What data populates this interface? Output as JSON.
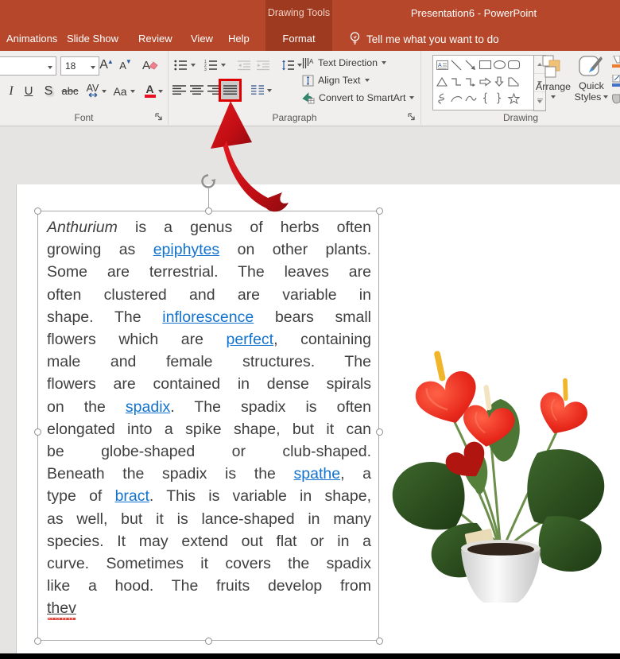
{
  "titlebar": {
    "context_group": "Drawing Tools",
    "title": "Presentation6  -  PowerPoint"
  },
  "tabs": {
    "items": [
      "Animations",
      "Slide Show",
      "Review",
      "View",
      "Help"
    ],
    "context_tab": "Format",
    "tell_me": "Tell me what you want to do"
  },
  "ribbon": {
    "font": {
      "label": "Font",
      "size_value": "18",
      "italic": "I",
      "underline": "U",
      "shadow": "S",
      "strikethrough": "abc",
      "char_spacing": "AV",
      "change_case": "Aa",
      "font_color": "A",
      "grow_font": "A",
      "shrink_font": "A",
      "clear_format": "A"
    },
    "paragraph": {
      "label": "Paragraph",
      "text_direction": "Text Direction",
      "align_text": "Align Text",
      "convert_smartart": "Convert to SmartArt"
    },
    "drawing": {
      "label": "Drawing",
      "arrange": "Arrange",
      "quick_line1": "Quick",
      "quick_line2": "Styles"
    }
  },
  "slide": {
    "textbox": {
      "lines": [
        [
          {
            "t": "Anthurium",
            "s": "i"
          },
          {
            "t": " is a genus of herbs often",
            "s": "n"
          }
        ],
        [
          {
            "t": "growing as ",
            "s": "n"
          },
          {
            "t": "epiphytes",
            "s": "l"
          },
          {
            "t": " on other plants.",
            "s": "n"
          }
        ],
        [
          {
            "t": "Some are terrestrial. The leaves are",
            "s": "n"
          }
        ],
        [
          {
            "t": "often clustered and are variable in",
            "s": "n"
          }
        ],
        [
          {
            "t": "shape. The ",
            "s": "n"
          },
          {
            "t": "inflorescence",
            "s": "l"
          },
          {
            "t": " bears small",
            "s": "n"
          }
        ],
        [
          {
            "t": "flowers which are ",
            "s": "n"
          },
          {
            "t": "perfect",
            "s": "l"
          },
          {
            "t": ", containing",
            "s": "n"
          }
        ],
        [
          {
            "t": "male and female structures. The",
            "s": "n"
          }
        ],
        [
          {
            "t": "flowers are contained in dense spirals",
            "s": "n"
          }
        ],
        [
          {
            "t": "on the ",
            "s": "n"
          },
          {
            "t": "spadix",
            "s": "l"
          },
          {
            "t": ". The spadix is often",
            "s": "n"
          }
        ],
        [
          {
            "t": "elongated into a spike shape, but it can",
            "s": "n"
          }
        ],
        [
          {
            "t": "be globe-shaped or club-shaped.",
            "s": "n"
          }
        ],
        [
          {
            "t": "Beneath the spadix is the ",
            "s": "n"
          },
          {
            "t": "spathe",
            "s": "l"
          },
          {
            "t": ", a",
            "s": "n"
          }
        ],
        [
          {
            "t": "type of ",
            "s": "n"
          },
          {
            "t": "bract",
            "s": "l"
          },
          {
            "t": ". This is variable in shape,",
            "s": "n"
          }
        ],
        [
          {
            "t": "as well, but it is lance-shaped in many",
            "s": "n"
          }
        ],
        [
          {
            "t": "species. It may extend out flat or in a",
            "s": "n"
          }
        ],
        [
          {
            "t": "curve. Sometimes it covers the spadix",
            "s": "n"
          }
        ],
        [
          {
            "t": "like a hood. The fruits develop from",
            "s": "n"
          }
        ],
        [
          {
            "t": "thev",
            "s": "u"
          }
        ]
      ]
    }
  },
  "colors": {
    "accent": "#B7472A",
    "context_dark": "#9E3A20",
    "hyperlink": "#1273CE",
    "annotation_red": "#DE0000",
    "ribbon_bg": "#F1EFED"
  }
}
